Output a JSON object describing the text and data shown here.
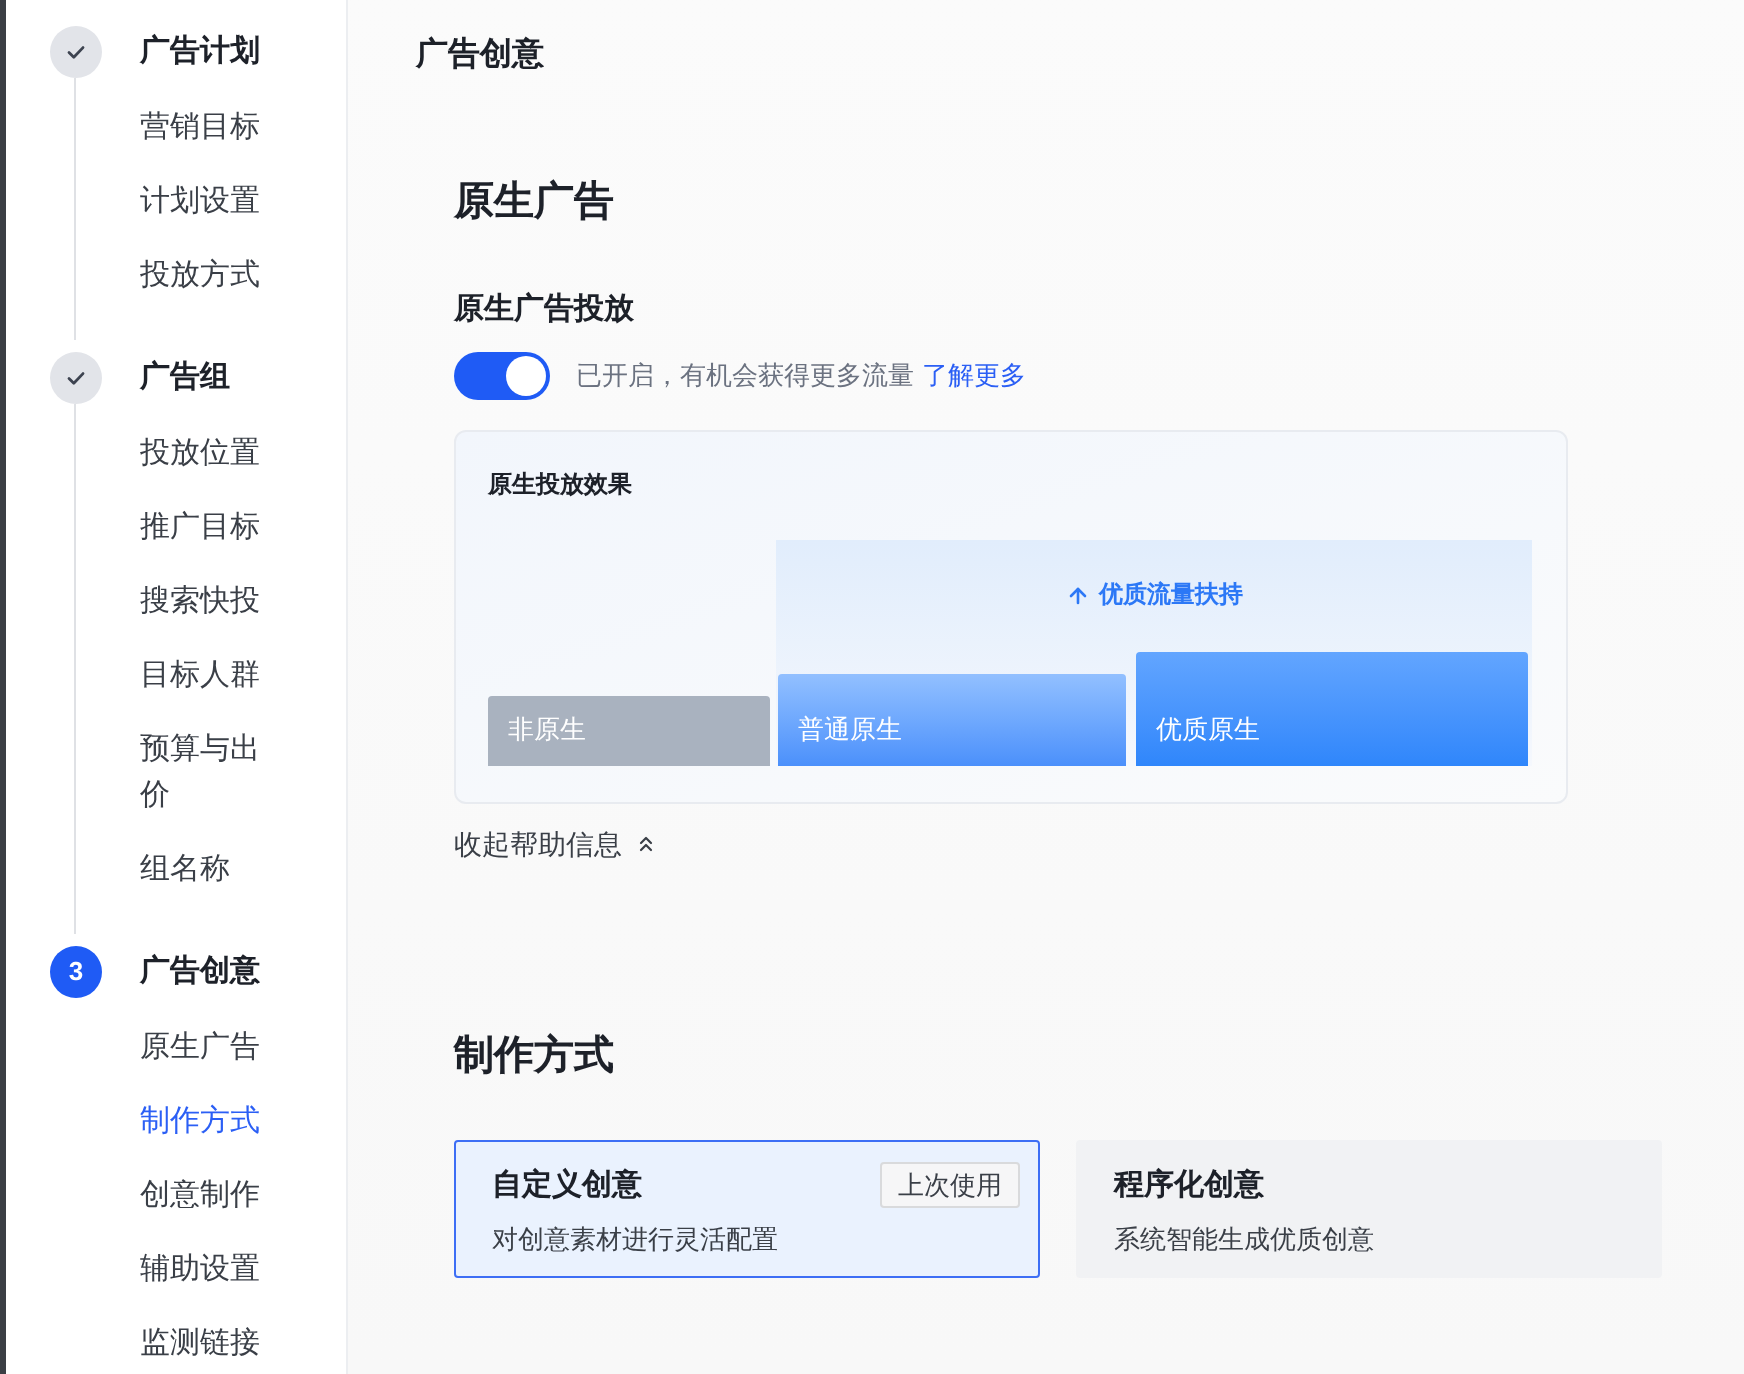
{
  "sidebar": {
    "steps": [
      {
        "completed": true,
        "title": "广告计划",
        "items": [
          {
            "label": "营销目标",
            "selected": false
          },
          {
            "label": "计划设置",
            "selected": false
          },
          {
            "label": "投放方式",
            "selected": false
          }
        ]
      },
      {
        "completed": true,
        "title": "广告组",
        "items": [
          {
            "label": "投放位置",
            "selected": false
          },
          {
            "label": "推广目标",
            "selected": false
          },
          {
            "label": "搜索快投",
            "selected": false
          },
          {
            "label": "目标人群",
            "selected": false
          },
          {
            "label": "预算与出价",
            "selected": false
          },
          {
            "label": "组名称",
            "selected": false
          }
        ]
      },
      {
        "completed": false,
        "number": "3",
        "title": "广告创意",
        "items": [
          {
            "label": "原生广告",
            "selected": false
          },
          {
            "label": "制作方式",
            "selected": true
          },
          {
            "label": "创意制作",
            "selected": false
          },
          {
            "label": "辅助设置",
            "selected": false
          },
          {
            "label": "监测链接",
            "selected": false
          }
        ]
      }
    ]
  },
  "main": {
    "title": "广告创意",
    "native_ads": {
      "title": "原生广告",
      "toggle": {
        "label": "原生广告投放",
        "on": true,
        "status_text": "已开启，有机会获得更多流量",
        "link": "了解更多"
      },
      "help_panel": {
        "title": "原生投放效果",
        "boost_label": "优质流量扶持",
        "bars": [
          {
            "label": "非原生",
            "kind": "basic"
          },
          {
            "label": "普通原生",
            "kind": "standard"
          },
          {
            "label": "优质原生",
            "kind": "premium"
          }
        ]
      },
      "collapse_link": "收起帮助信息"
    },
    "creation_method": {
      "title": "制作方式",
      "options": [
        {
          "title": "自定义创意",
          "description": "对创意素材进行灵活配置",
          "badge": "上次使用",
          "selected": true
        },
        {
          "title": "程序化创意",
          "description": "系统智能生成优质创意",
          "selected": false
        }
      ]
    }
  }
}
